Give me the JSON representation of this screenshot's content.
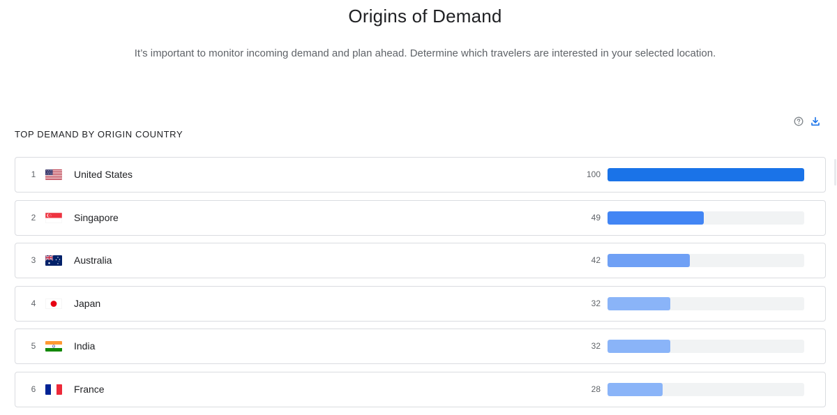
{
  "header": {
    "title": "Origins of Demand",
    "subtitle": "It’s important to monitor incoming demand and plan ahead. Determine which travelers are interested in your selected location."
  },
  "section": {
    "title": "TOP DEMAND BY ORIGIN COUNTRY",
    "help_icon": "help-circle-icon",
    "download_icon": "download-icon"
  },
  "colors": {
    "bar_max": "#1a73e8",
    "bar_high": "#4285f4",
    "bar_mid": "#6fa0f5",
    "bar_low": "#8ab4f8",
    "track": "#f1f3f4",
    "accent": "#1a73e8"
  },
  "chart_data": {
    "type": "bar",
    "title": "TOP DEMAND BY ORIGIN COUNTRY",
    "categories": [
      "United States",
      "Singapore",
      "Australia",
      "Japan",
      "India",
      "France"
    ],
    "values": [
      100,
      49,
      42,
      32,
      32,
      28
    ],
    "ylim": [
      0,
      100
    ]
  },
  "rows": [
    {
      "rank": "1",
      "country": "United States",
      "value": "100",
      "score": 100,
      "flag": "us-flag-icon",
      "color": "#1a73e8"
    },
    {
      "rank": "2",
      "country": "Singapore",
      "value": "49",
      "score": 49,
      "flag": "sg-flag-icon",
      "color": "#4285f4"
    },
    {
      "rank": "3",
      "country": "Australia",
      "value": "42",
      "score": 42,
      "flag": "au-flag-icon",
      "color": "#6fa0f5"
    },
    {
      "rank": "4",
      "country": "Japan",
      "value": "32",
      "score": 32,
      "flag": "jp-flag-icon",
      "color": "#8ab4f8"
    },
    {
      "rank": "5",
      "country": "India",
      "value": "32",
      "score": 32,
      "flag": "in-flag-icon",
      "color": "#8ab4f8"
    },
    {
      "rank": "6",
      "country": "France",
      "value": "28",
      "score": 28,
      "flag": "fr-flag-icon",
      "color": "#8ab4f8"
    }
  ]
}
